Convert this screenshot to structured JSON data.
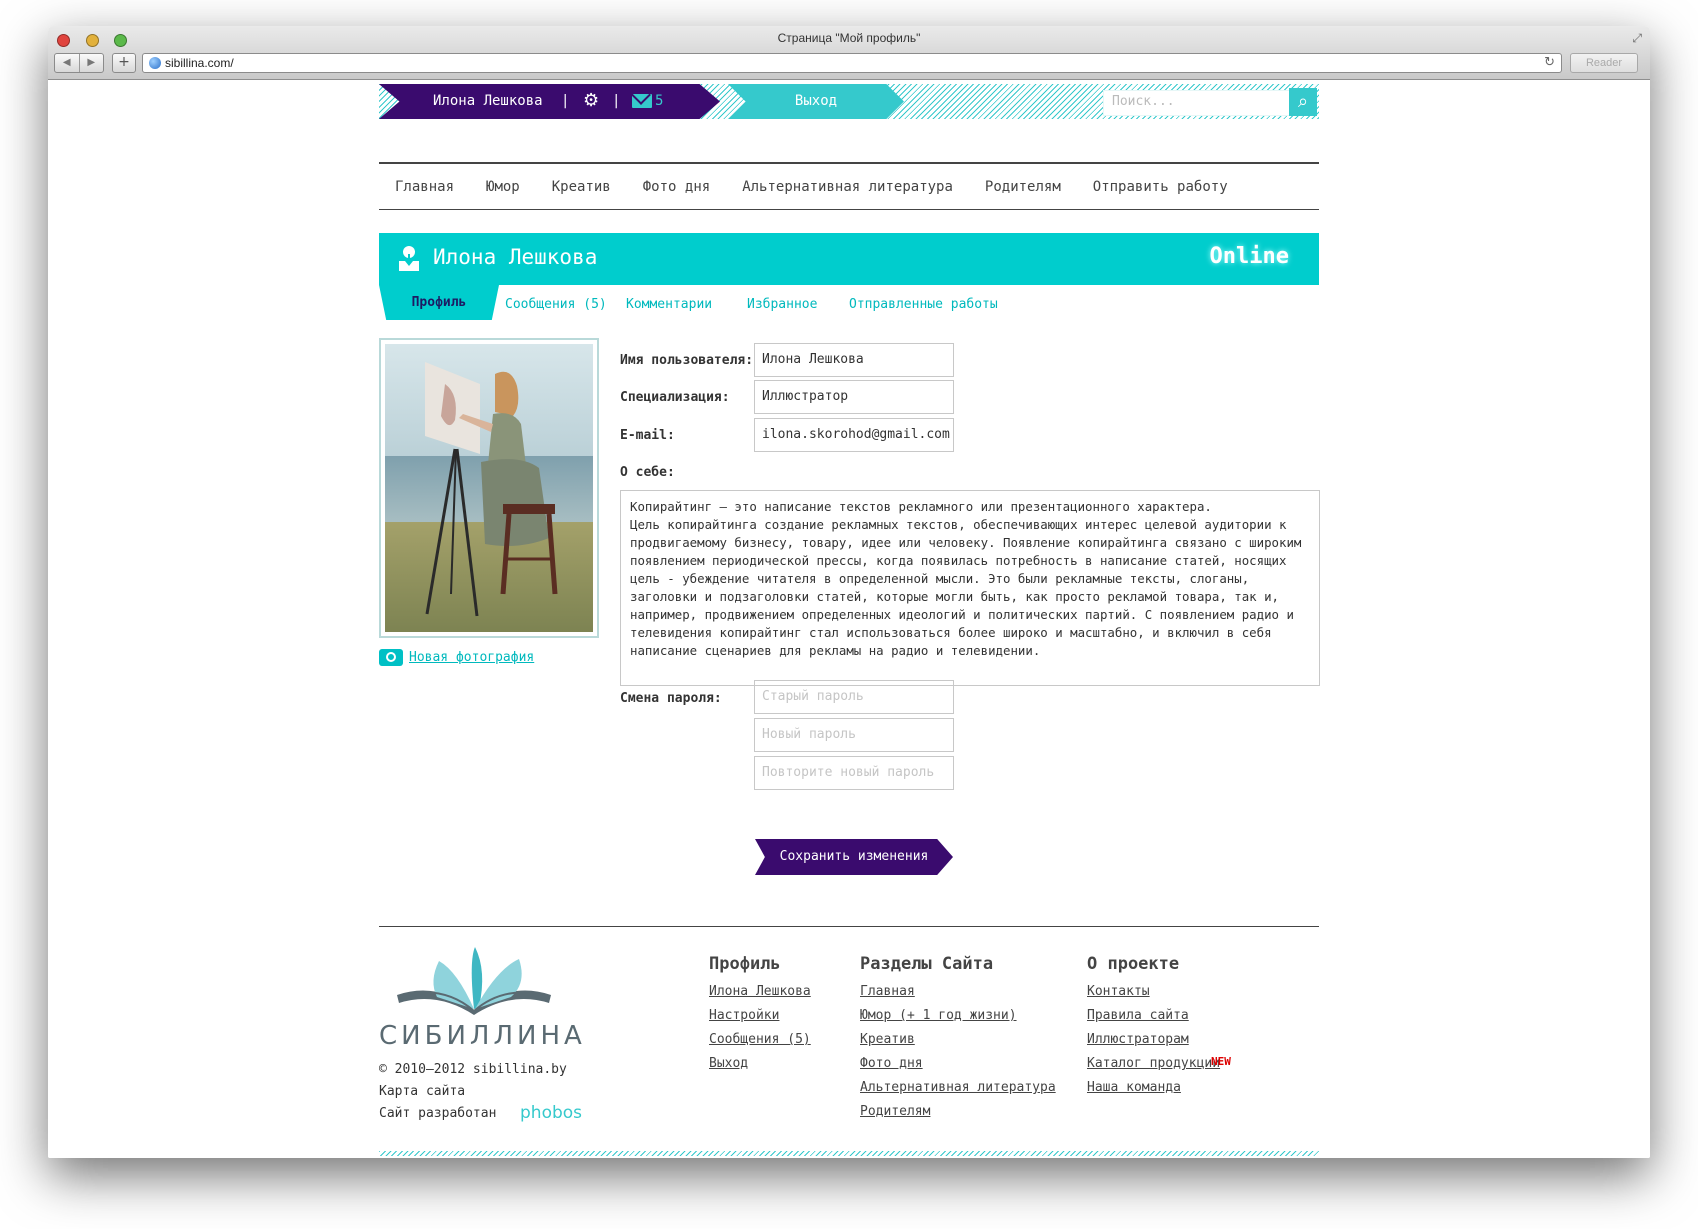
{
  "browser": {
    "window_title": "Страница \"Мой профиль\"",
    "url": "sibillina.com/",
    "reader_label": "Reader",
    "back_icon": "◀",
    "forward_icon": "▶",
    "add_label": "+",
    "reload_icon": "↻",
    "resize_icon": "⤢"
  },
  "topbar": {
    "user_name": "Илона Лешкова",
    "separator": "|",
    "gear_icon": "⚙",
    "mail_count": "5",
    "logout": "Выход",
    "search_placeholder": "Поиск...",
    "search_icon": "⌕"
  },
  "main_nav": [
    "Главная",
    "Юмор",
    "Креатив",
    "Фото дня",
    "Альтернативная литература",
    "Родителям",
    "Отправить работу"
  ],
  "profile": {
    "name": "Илона Лешкова",
    "status": "Online",
    "tabs": [
      "Профиль",
      "Сообщения (5)",
      "Комментарии",
      "Избранное",
      "Отправленные работы"
    ],
    "new_photo": "Новая фотография",
    "labels": {
      "username": "Имя пользователя:",
      "specialization": "Специализация:",
      "email": "E-mail:",
      "about": "О себе:",
      "password": "Смена пароля:"
    },
    "values": {
      "username": "Илона Лешкова",
      "specialization": "Иллюстратор",
      "email": "ilona.skorohod@gmail.com"
    },
    "about_text": "Копирайтинг – это написание текстов рекламного или презентационного характера.\nЦель копирайтинга создание рекламных текстов, обеспечивающих интерес целевой аудитории к продвигаемому бизнесу, товару, идее или человеку. Появление копирайтинга связано с широким\nпоявлением периодической прессы, когда появилась потребность в написание статей, носящих цель - убеждение читателя в определенной мысли. Это были рекламные тексты, слоганы, заголовки и подзаголовки статей, которые могли быть, как просто рекламой товара, так и, например, продвижением определенных идеологий и политических партий. С появлением радио и телевидения копирайтинг стал использоваться более широко и масштабно, и включил в себя написание сценариев для рекламы на радио и телевидении.",
    "password_placeholders": {
      "old": "Старый пароль",
      "new": "Новый пароль",
      "repeat": "Повторите новый пароль"
    },
    "save": "Сохранить изменения"
  },
  "footer": {
    "logo_text": "СИБИЛЛИНА",
    "copyright": "© 2010–2012 sibillina.by",
    "sitemap": "Карта сайта",
    "developed_by": "Сайт разработан",
    "developer": "phobos",
    "columns": [
      {
        "title": "Профиль",
        "links": [
          "Илона Лешкова",
          "Настройки",
          "Сообщения (5)",
          "Выход"
        ]
      },
      {
        "title": "Разделы Сайта",
        "links": [
          "Главная",
          "Юмор (+ 1 год жизни)",
          "Креатив",
          "Фото дня",
          "Альтернативная литература",
          "Родителям"
        ]
      },
      {
        "title": "О проекте",
        "links": [
          "Контакты",
          "Правила сайта",
          "Иллюстраторам",
          "Каталог продукции",
          "Наша команда"
        ]
      }
    ],
    "new_badge": "NEW"
  },
  "colors": {
    "accent_cyan": "#00cdcd",
    "accent_purple": "#3a0b6e",
    "text": "#333333",
    "badge_red": "#dd0000"
  }
}
